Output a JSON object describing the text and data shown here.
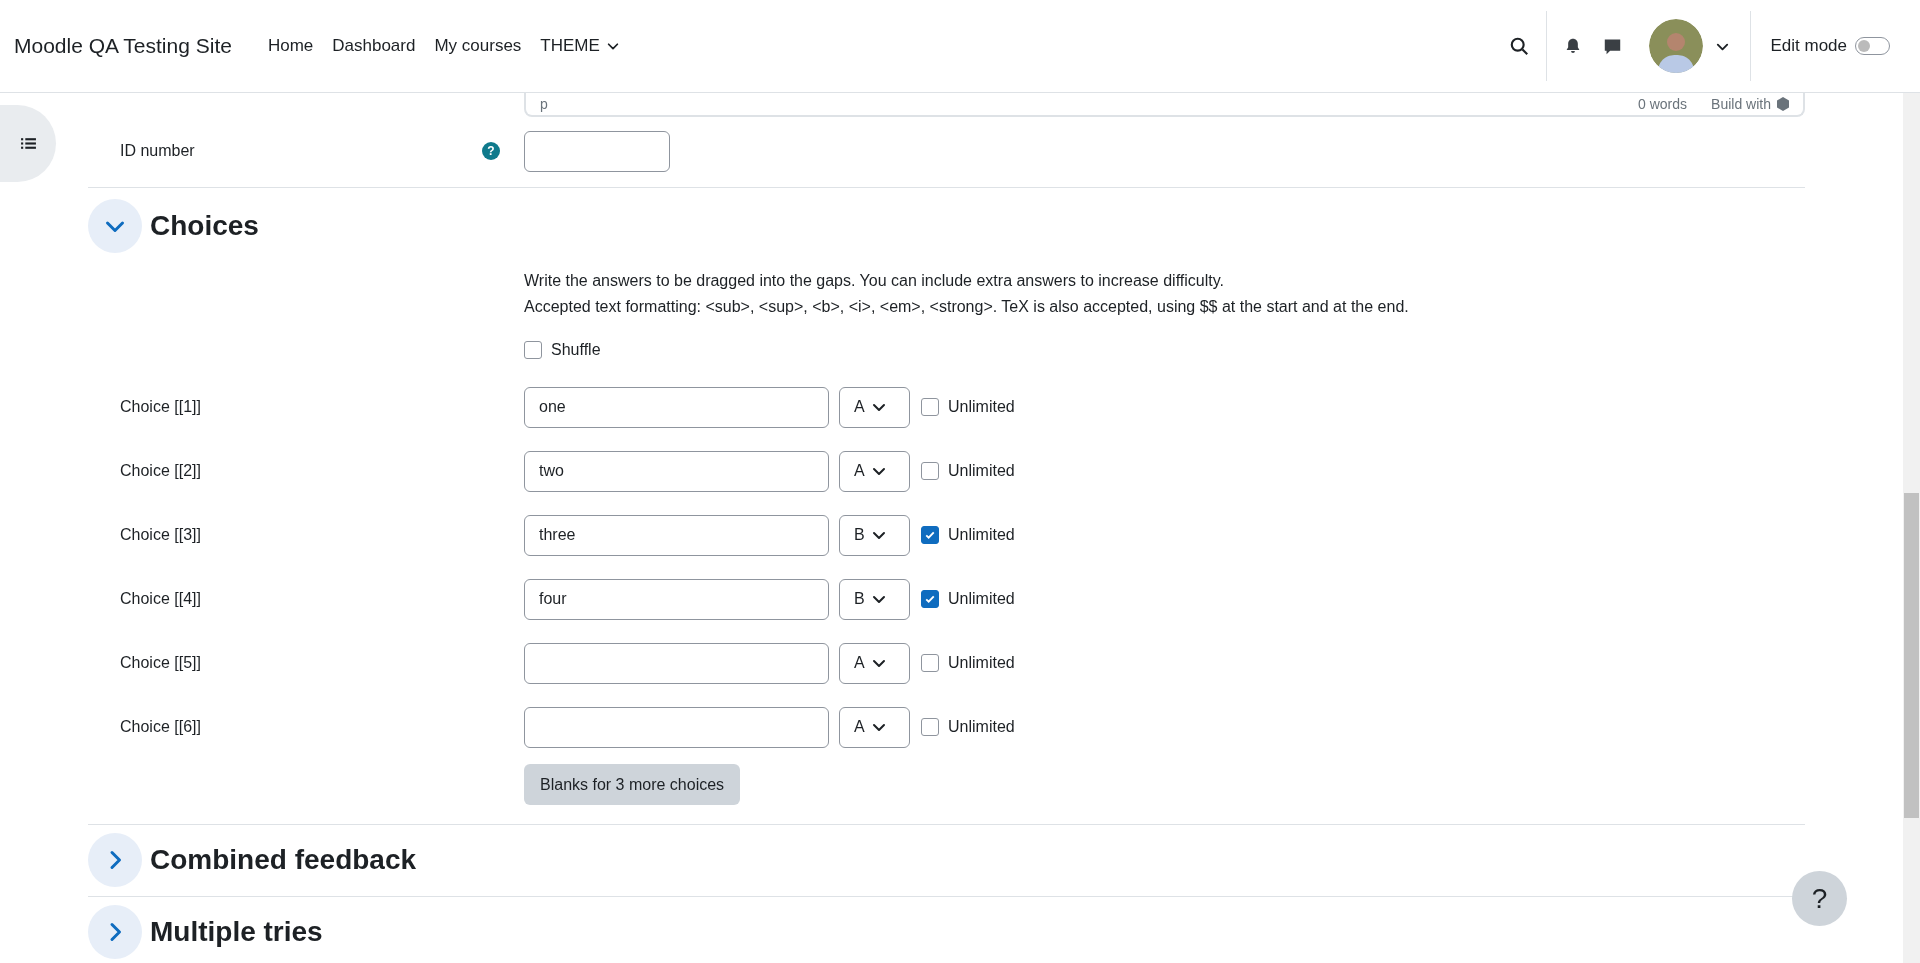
{
  "header": {
    "site_name": "Moodle QA Testing Site",
    "nav": [
      {
        "label": "Home",
        "dropdown": false
      },
      {
        "label": "Dashboard",
        "dropdown": false
      },
      {
        "label": "My courses",
        "dropdown": false
      },
      {
        "label": "THEME",
        "dropdown": true
      }
    ],
    "edit_mode": {
      "label": "Edit mode",
      "on": false
    }
  },
  "editor_status": {
    "path": "p",
    "word_count": "0 words",
    "branding": "Build with"
  },
  "id_number": {
    "label": "ID number",
    "help": "?"
  },
  "sections": [
    {
      "title": "Choices",
      "expanded": true
    },
    {
      "title": "Combined feedback",
      "expanded": false
    },
    {
      "title": "Multiple tries",
      "expanded": false
    }
  ],
  "choices": {
    "instructions": [
      "Write the answers to be dragged into the gaps. You can include extra answers to increase difficulty.",
      "Accepted text formatting: <sub>, <sup>, <b>, <i>, <em>, <strong>. TeX is also accepted, using $$ at the start and at the end."
    ],
    "shuffle": {
      "label": "Shuffle",
      "checked": false
    },
    "rows": [
      {
        "label": "Choice [[1]]",
        "value": "one",
        "group": "A",
        "unlimited_label": "Unlimited",
        "unlimited": false
      },
      {
        "label": "Choice [[2]]",
        "value": "two",
        "group": "A",
        "unlimited_label": "Unlimited",
        "unlimited": false
      },
      {
        "label": "Choice [[3]]",
        "value": "three",
        "group": "B",
        "unlimited_label": "Unlimited",
        "unlimited": true
      },
      {
        "label": "Choice [[4]]",
        "value": "four",
        "group": "B",
        "unlimited_label": "Unlimited",
        "unlimited": true
      },
      {
        "label": "Choice [[5]]",
        "value": "",
        "group": "A",
        "unlimited_label": "Unlimited",
        "unlimited": false
      },
      {
        "label": "Choice [[6]]",
        "value": "",
        "group": "A",
        "unlimited_label": "Unlimited",
        "unlimited": false
      }
    ],
    "more_button": "Blanks for 3 more choices"
  },
  "help_button": "?"
}
